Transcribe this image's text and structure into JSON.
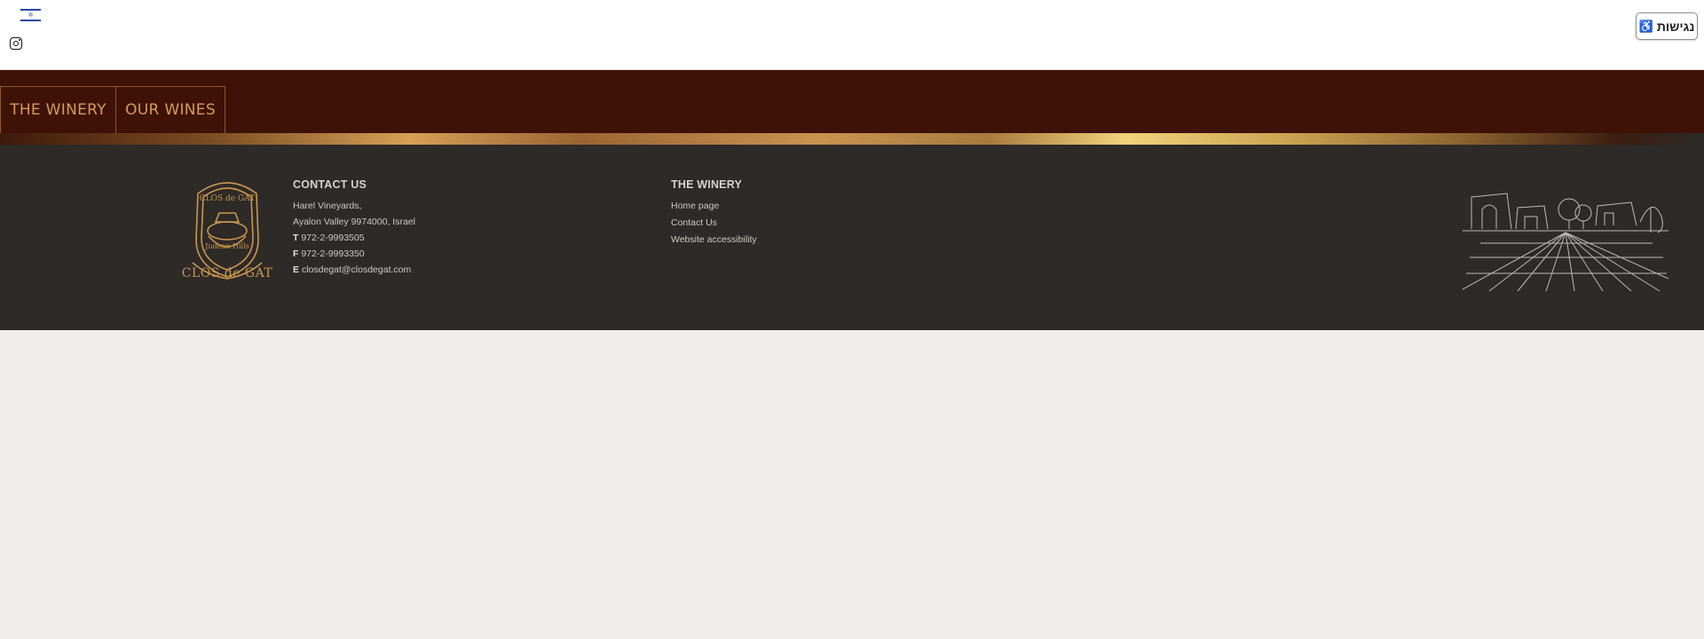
{
  "topbar": {
    "flag_icon": "israel-flag-icon",
    "instagram_icon": "instagram-icon",
    "accessibility": {
      "label": "נגישות",
      "icon": "wheelchair-icon"
    }
  },
  "nav": {
    "tabs": [
      {
        "label": "THE WINERY"
      },
      {
        "label": "OUR WINES"
      }
    ]
  },
  "footer": {
    "logo": {
      "word": "CLOS de GAT",
      "badge_top": "CLOS de GAT",
      "badge_bottom": "Judean Hills"
    },
    "contact": {
      "heading": "CONTACT US",
      "address1": "Harel Vineyards,",
      "address2": "Ayalon Valley 9974000, Israel",
      "phone_prefix": "T",
      "phone": "972-2-9993505",
      "fax_prefix": "F",
      "fax": "972-2-9993350",
      "email_prefix": "E",
      "email": "closdegat@closdegat.com"
    },
    "winery": {
      "heading": "THE WINERY",
      "links": [
        "Home page",
        "Contact Us",
        "Website accessibility"
      ]
    }
  },
  "colors": {
    "nav_bg": "#3e1206",
    "nav_text": "#d49b58",
    "footer_bg": "#2e2a27",
    "page_bg": "#f1edea",
    "gold": "#c9974f"
  }
}
